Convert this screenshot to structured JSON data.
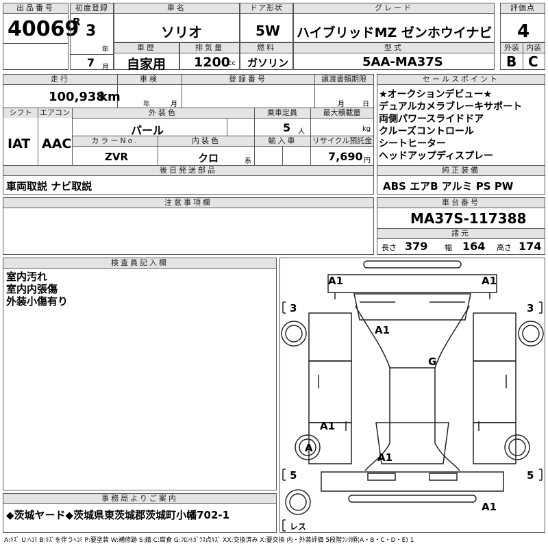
{
  "headers": {
    "lot_no": "出品番号",
    "first_reg": "初度登録",
    "car_name": "車名",
    "door": "ドア形状",
    "grade": "グレード",
    "score": "評価点",
    "history": "車歴",
    "displacement": "排気量",
    "fuel": "燃料",
    "model": "型式",
    "exterior": "外装",
    "interior": "内装",
    "mileage": "走行",
    "inspection": "車検",
    "reg_no": "登録番号",
    "transfer_deadline": "譲渡書類期限",
    "sales_points": "セールスポイント",
    "shift": "シフト",
    "aircon": "エアコン",
    "color": "外装色",
    "capacity": "乗車定員",
    "max_load": "最大積載量",
    "color_no": "カラーNo.",
    "interior_color": "内装色",
    "import": "輸入車",
    "recycle": "リサイクル預託金",
    "later_parts": "後日発送部品",
    "genuine_equipment": "純正装備",
    "notes": "注意事項欄",
    "chassis_no": "車台番号",
    "dimensions": "諸元",
    "inspector": "検査員記入欄",
    "office": "事務局よりご案内"
  },
  "vehicle": {
    "lot_no": "40069",
    "era": "R",
    "year": "3",
    "year_unit": "年",
    "month": "7",
    "month_unit": "月",
    "car_name": "ソリオ",
    "door": "5W",
    "grade": "ハイブリッドMZ ゼンホウイナビ",
    "score": "4",
    "history": "自家用",
    "displacement": "1200",
    "displacement_unit": "cc",
    "fuel": "ガソリン",
    "model": "5AA-MA37S",
    "exterior_score": "B",
    "interior_score": "C",
    "mileage": "100,938",
    "mileage_unit": "km",
    "inspection_year_unit": "年",
    "inspection_month_unit": "月",
    "transfer_month_unit": "月",
    "transfer_day_unit": "日",
    "shift": "IAT",
    "aircon": "AAC",
    "color": "パール",
    "capacity": "5",
    "capacity_unit": "人",
    "max_load_unit": "kg",
    "color_no": "ZVR",
    "interior_color": "クロ",
    "interior_color_unit": "系",
    "recycle": "7,690",
    "recycle_unit": "円",
    "chassis_no": "MA37S-117388",
    "length_label": "長さ",
    "length": "379",
    "width_label": "幅",
    "width": "164",
    "height_label": "高さ",
    "height": "174"
  },
  "sales_points": [
    "★オークションデビュー★",
    "デュアルカメラブレーキサポート",
    "両側パワースライドドア",
    "クルーズコントロール",
    "シートヒーター",
    "ヘッドアップディスプレー"
  ],
  "later_parts": "車両取説 ナビ取説",
  "genuine_equipment": "ABS エアB アルミ PS PW",
  "inspector_notes": [
    "室内汚れ",
    "室内内張傷",
    "外装小傷有り"
  ],
  "office_notice": "◆茨城ヤード◆茨城県東茨城郡茨城町小幡702-1",
  "diagram": {
    "tire_left_front": "3",
    "tire_right_front": "3",
    "tire_left_rear": "5",
    "tire_right_rear": "5",
    "spare": "レス",
    "marks": [
      "A1",
      "A1",
      "A1",
      "G",
      "A1",
      "A",
      "A1",
      "A1"
    ]
  },
  "legend": "A:ｷｽﾞ U:ﾍｺﾐ B:ｷｽﾞを伴うﾍｺﾐ P:要塗装 W:補修跡 S:錆 C:腐食 G:ﾌﾛﾝﾄｶﾞﾗｽ点ｷｽﾞ XX:交換済み X:要交換 内・外装評価 5段階ﾗﾝｸ順(A・B・C・D・E) 1"
}
